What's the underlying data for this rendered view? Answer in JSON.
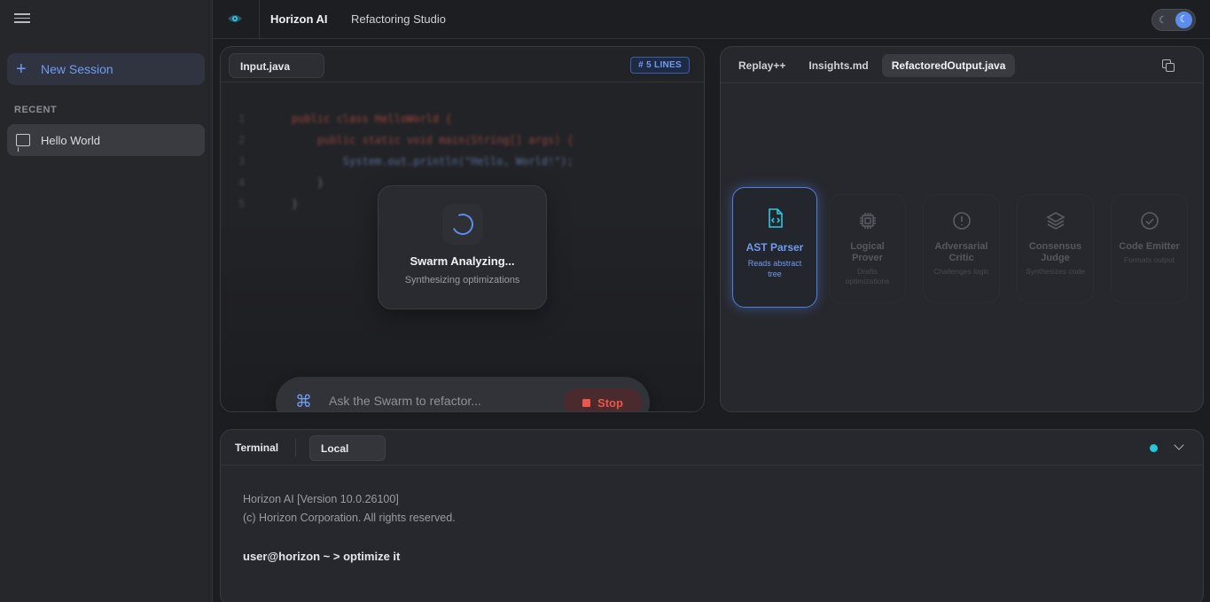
{
  "sidebar": {
    "new_session_label": "New Session",
    "recent_label": "RECENT",
    "sessions": [
      {
        "label": "Hello World"
      }
    ]
  },
  "header": {
    "title": "Horizon AI",
    "subtitle": "Refactoring Studio",
    "theme": "dark"
  },
  "input_panel": {
    "file_tab": "Input.java",
    "lines_badge": "# 5 LINES",
    "code_lines": [
      {
        "num": "1",
        "code": "public class HelloWorld {"
      },
      {
        "num": "2",
        "code": "    public static void main(String[] args) {"
      },
      {
        "num": "3",
        "code": "        System.out.println(\"Hello, World!\");"
      },
      {
        "num": "4",
        "code": "    }"
      },
      {
        "num": "5",
        "code": "}"
      }
    ],
    "status_title": "Swarm Analyzing...",
    "status_subtitle": "Synthesizing optimizations",
    "prompt_placeholder": "Ask the Swarm to refactor...",
    "stop_label": "Stop"
  },
  "output_panel": {
    "tabs": [
      {
        "label": "Replay++",
        "active": false
      },
      {
        "label": "Insights.md",
        "active": false
      },
      {
        "label": "RefactoredOutput.java",
        "active": true
      }
    ],
    "agents": [
      {
        "name": "AST Parser",
        "desc": "Reads abstract tree",
        "icon": "file-code-icon",
        "active": true
      },
      {
        "name": "Logical Prover",
        "desc": "Drafts optimizations",
        "icon": "cpu-icon",
        "active": false
      },
      {
        "name": "Adversarial Critic",
        "desc": "Challenges logic",
        "icon": "alert-circle-icon",
        "active": false
      },
      {
        "name": "Consensus Judge",
        "desc": "Synthesizes code",
        "icon": "layers-icon",
        "active": false
      },
      {
        "name": "Code Emitter",
        "desc": "Formats output",
        "icon": "check-circle-icon",
        "active": false
      }
    ]
  },
  "terminal": {
    "title": "Terminal",
    "tab": "Local",
    "lines": [
      "Horizon AI [Version 10.0.26100]",
      "(c) Horizon Corporation. All rights reserved."
    ],
    "command": "user@horizon ~ > optimize it"
  },
  "colors": {
    "accent": "#5b8def",
    "active_agent_icon": "#2fc7e0",
    "stop": "#e8574a",
    "status_dot": "#22c8dc"
  }
}
